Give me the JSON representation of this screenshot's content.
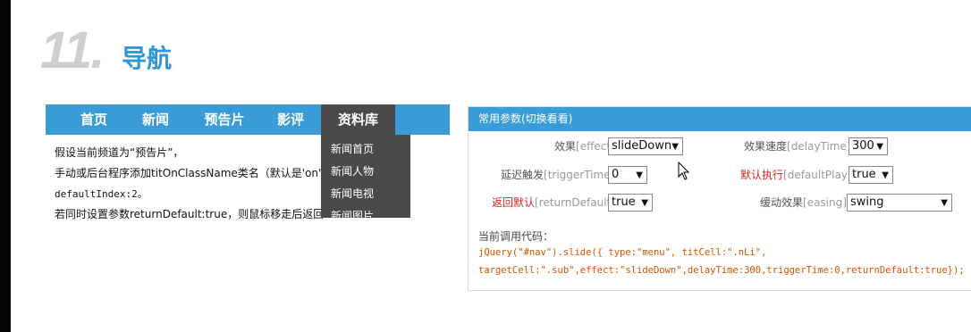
{
  "section": {
    "number": "11.",
    "title": "导航"
  },
  "nav": {
    "items": [
      {
        "label": "首页"
      },
      {
        "label": "新闻"
      },
      {
        "label": "预告片"
      },
      {
        "label": "影评"
      },
      {
        "label": "资料库"
      }
    ],
    "dropdown": [
      "新闻首页",
      "新闻人物",
      "新闻电视",
      "新闻图片"
    ]
  },
  "description": [
    "假设当前频道为“预告片”，",
    "手动或后台程序添加titOnClassName类名（默认是'on'），",
    "defaultIndex:2。",
    "若同时设置参数returnDefault:true，则鼠标移走后返回"
  ],
  "panel": {
    "title": "常用参数(切换看看)",
    "params": {
      "effect": {
        "cn": "效果",
        "key": "[effect]",
        "colon": ":",
        "value": "slideDown"
      },
      "delayTime": {
        "cn": "效果速度",
        "key": "[delayTime]",
        "colon": ":",
        "value": "300"
      },
      "triggerTime": {
        "cn": "延迟触发",
        "key": "[triggerTime]",
        "colon": ":",
        "value": "0"
      },
      "defaultPlay": {
        "cn": "默认执行",
        "key": "[defaultPlay]",
        "colon": ":",
        "value": "true"
      },
      "returnDefault": {
        "cn": "返回默认",
        "key": "[returnDefault]",
        "colon": ":",
        "value": "true"
      },
      "easing": {
        "cn": "缓动效果",
        "key": "[easing]",
        "colon": ":",
        "value": "swing"
      }
    },
    "code_label": "当前调用代码：",
    "code_line1": "jQuery(\"#nav\").slide({ type:\"menu\",  titCell:\".nLi\",",
    "code_line2": "targetCell:\".sub\",effect:\"slideDown\",delayTime:300,triggerTime:0,returnDefault:true});"
  },
  "colors": {
    "accent": "#3a9cd6",
    "dark": "#4a4a4a",
    "highlight": "#e02020",
    "code": "#d35400"
  }
}
